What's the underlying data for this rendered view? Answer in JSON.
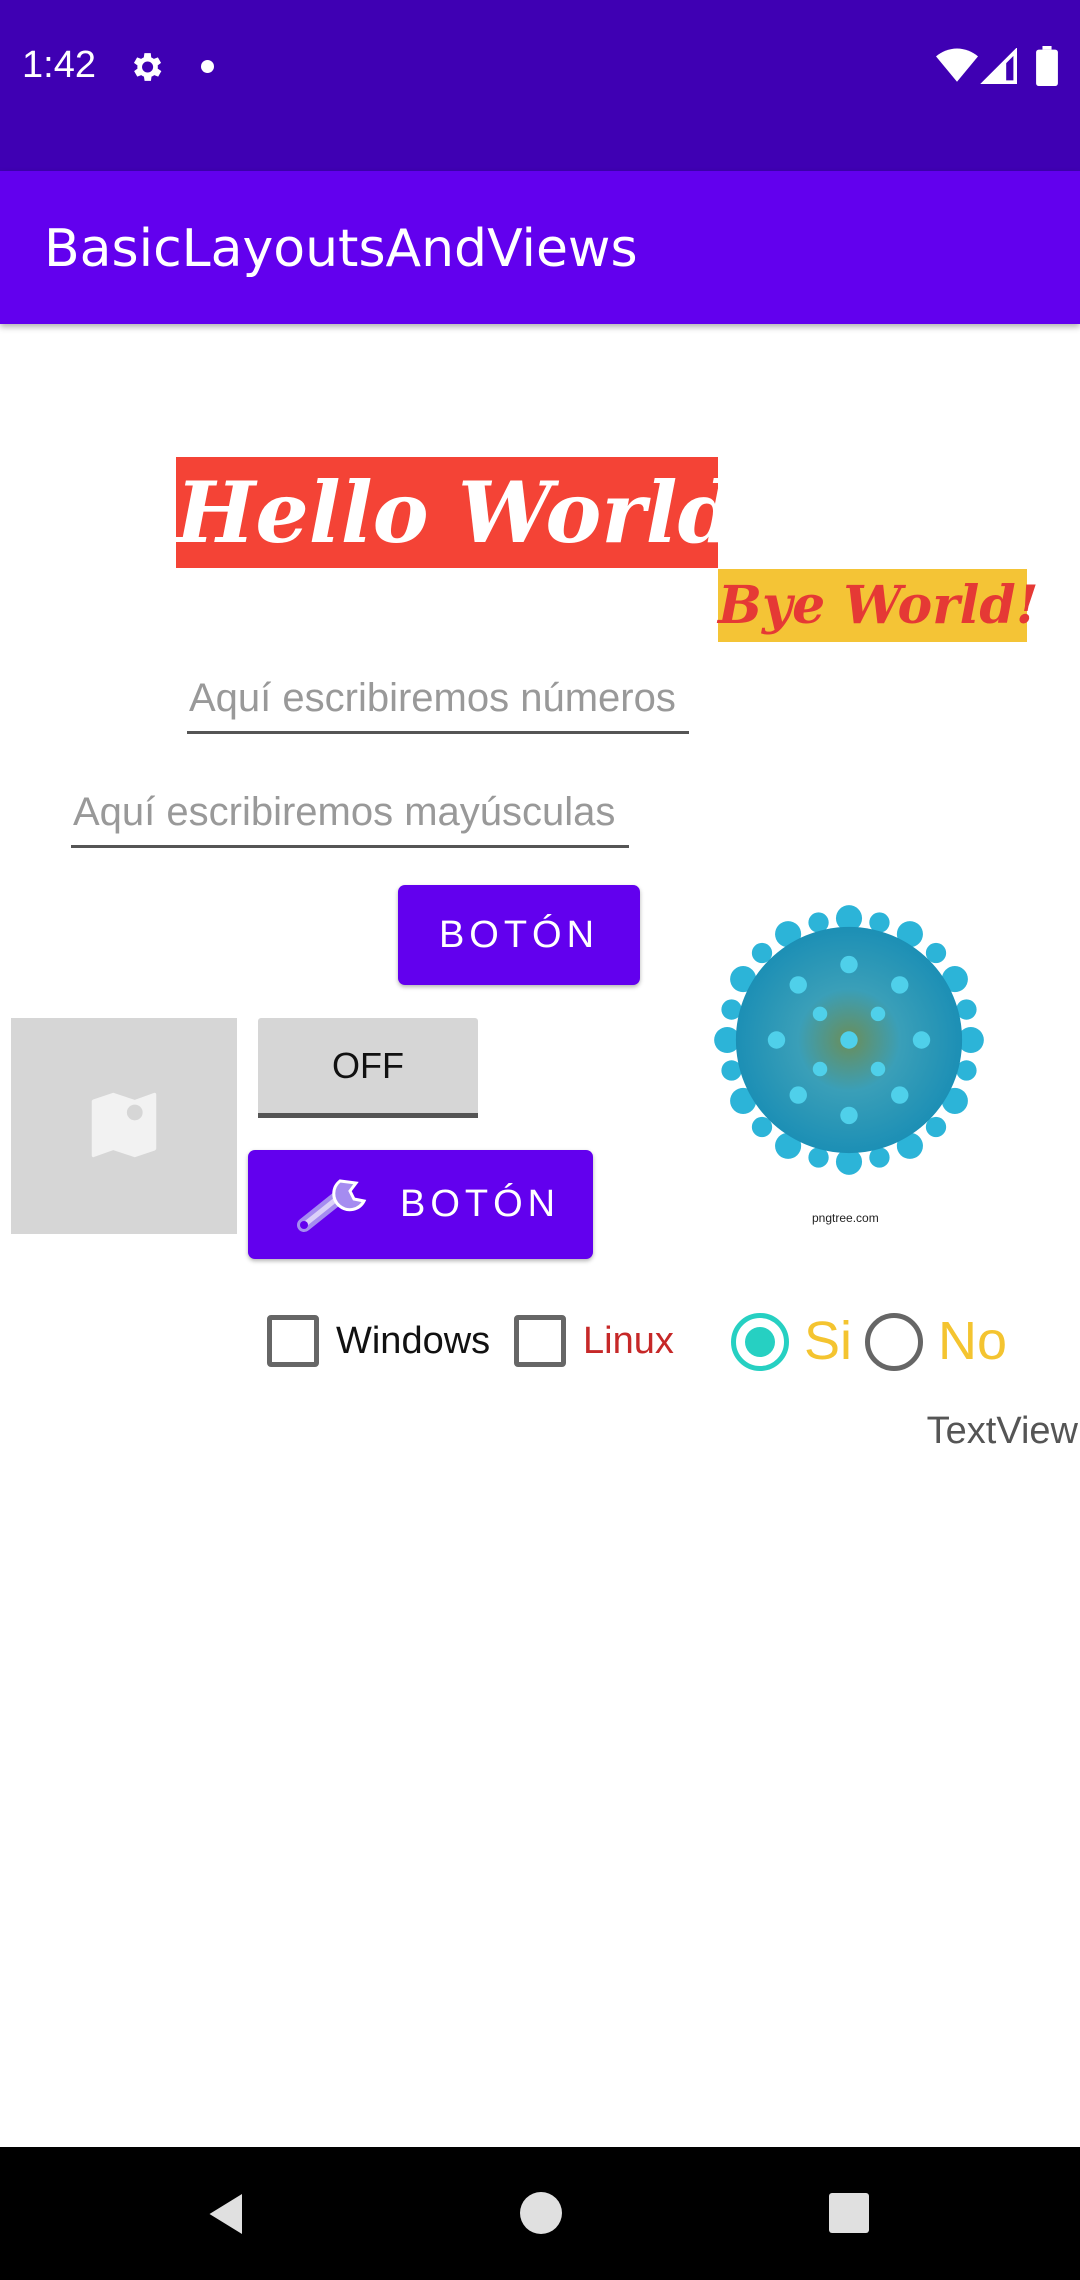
{
  "status_bar": {
    "time": "1:42",
    "icons": [
      "gear-icon",
      "notification-dot-icon",
      "wifi-icon",
      "cell-signal-icon",
      "battery-icon"
    ]
  },
  "app_bar": {
    "title": "BasicLayoutsAndViews"
  },
  "texts": {
    "hello": "Hello World!",
    "bye": "Bye World!"
  },
  "inputs": {
    "numbers_placeholder": "Aquí escribiremos números",
    "upper_placeholder": "Aquí escribiremos mayúsculas"
  },
  "buttons": {
    "primary_label": "BOTÓN",
    "icon_button_label": "BOTÓN",
    "toggle_label": "OFF"
  },
  "image": {
    "caption": "pngtree.com"
  },
  "checkboxes": [
    {
      "label": "Windows",
      "checked": false
    },
    {
      "label": "Linux",
      "checked": false
    }
  ],
  "radios": [
    {
      "label": "Si",
      "selected": true
    },
    {
      "label": "No",
      "selected": false
    }
  ],
  "textview": "TextView",
  "colors": {
    "status_bar": "#3f00b3",
    "app_bar": "#6200ee",
    "hello_bg": "#f44336",
    "bye_bg": "#f4c436",
    "bye_text": "#e53935",
    "linux_text": "#c62828",
    "radio_accent": "#26d0c2",
    "radio_text": "#f4c430"
  }
}
